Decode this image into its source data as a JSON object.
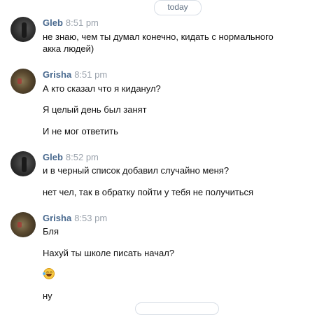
{
  "date_separator": "today",
  "messages": [
    {
      "author": "Gleb",
      "time": "8:51 pm",
      "avatar": "gleb-avatar",
      "lines": [
        "не знаю, чем ты думал конечно, кидать с нормального",
        "акка людей)"
      ]
    },
    {
      "author": "Grisha",
      "time": "8:51 pm",
      "avatar": "grisha-avatar",
      "lines": [
        "А кто сказал что я киданул?",
        "Я целый день был занят",
        "И не мог ответить"
      ]
    },
    {
      "author": "Gleb",
      "time": "8:52 pm",
      "avatar": "gleb-avatar",
      "lines": [
        "и в черный список добавил случайно меня?",
        "нет чел, так в обратку пойти у тебя не получиться"
      ]
    },
    {
      "author": "Grisha",
      "time": "8:53 pm",
      "avatar": "grisha-avatar",
      "lines": [
        "Бля",
        "Нахуй ты школе писать начал?",
        "ну"
      ],
      "emoji": "tears-of-joy-emoji"
    }
  ],
  "colors": {
    "author": "#4a6a8f",
    "time": "#9aa2ac",
    "separator_text": "#5f6f82"
  }
}
